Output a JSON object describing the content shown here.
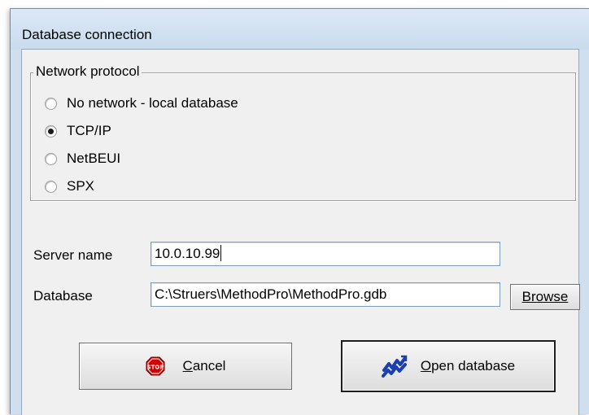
{
  "window": {
    "title": "Database connection"
  },
  "protocol": {
    "legend": "Network protocol",
    "options": [
      {
        "label": "No network - local database",
        "checked": false
      },
      {
        "label": "TCP/IP",
        "checked": true
      },
      {
        "label": "NetBEUI",
        "checked": false
      },
      {
        "label": "SPX",
        "checked": false
      }
    ]
  },
  "server": {
    "label": "Server name",
    "value": "10.0.10.99"
  },
  "database": {
    "label": "Database",
    "value": "C:\\Struers\\MethodPro\\MethodPro.gdb"
  },
  "buttons": {
    "browse": "Browse",
    "cancel": "Cancel",
    "open": "Open database"
  },
  "icons": {
    "cancel": "stop-sign-icon",
    "open": "database-connect-icon",
    "stop_color": "#d40000",
    "open_color": "#1c3fb0"
  }
}
